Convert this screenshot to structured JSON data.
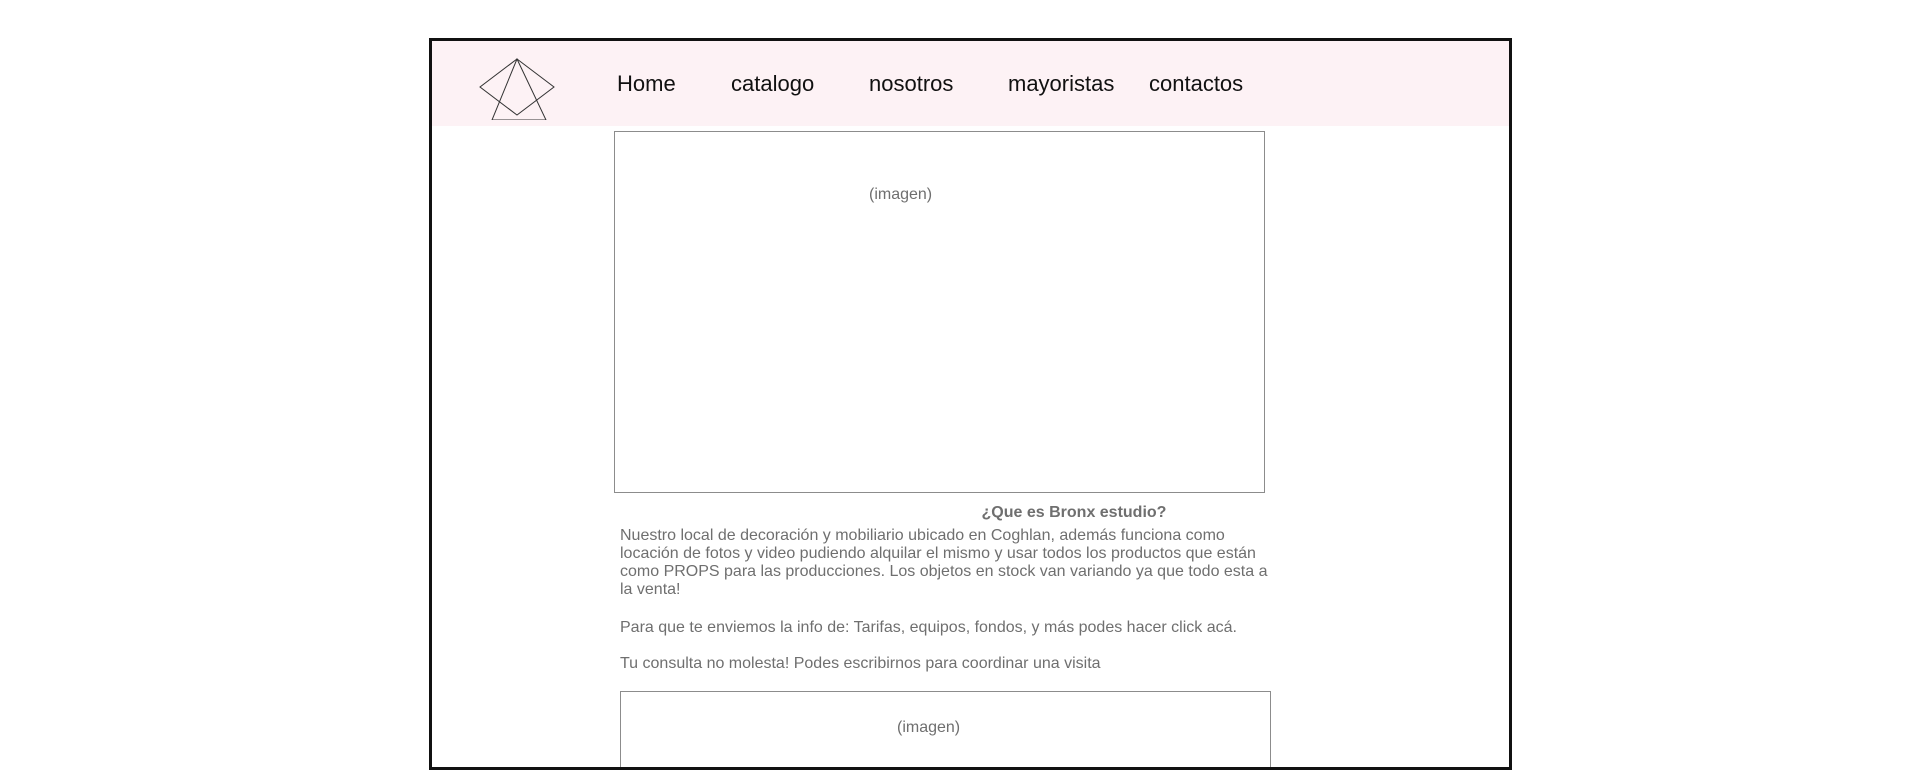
{
  "nav": {
    "items": [
      {
        "label": "Home"
      },
      {
        "label": "catalogo"
      },
      {
        "label": "nosotros"
      },
      {
        "label": "mayoristas"
      },
      {
        "label": "contactos"
      }
    ]
  },
  "hero_image": {
    "label": "(imagen)"
  },
  "about": {
    "title": "¿Que es Bronx estudio?",
    "paragraph1": "Nuestro local de decoración y mobiliario ubicado en Coghlan, además funciona como locación de fotos y video pudiendo alquilar el mismo y usar todos los productos que están como PROPS para las producciones. Los objetos en stock van variando ya que todo esta a la venta!",
    "paragraph2": "Para que te enviemos la info de: Tarifas, equipos, fondos, y más podes hacer click acá.",
    "paragraph3": "Tu consulta no molesta! Podes escribirnos para coordinar una visita"
  },
  "second_image": {
    "label": "(imagen)"
  },
  "colors": {
    "nav_background": "#fdf2f5",
    "frame_border": "#111111",
    "muted_text": "#6f6f6f"
  }
}
